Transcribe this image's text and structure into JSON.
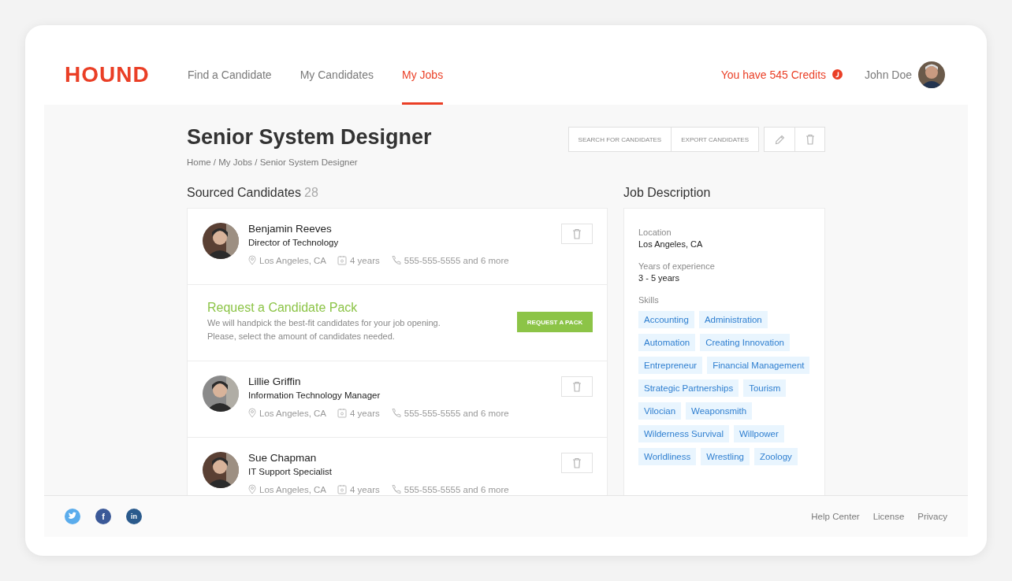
{
  "logo": "HOUND",
  "nav": [
    {
      "label": "Find a Candidate",
      "selected": false
    },
    {
      "label": "My Candidates",
      "selected": false
    },
    {
      "label": "My Jobs",
      "selected": true
    }
  ],
  "credits": "You have 545 Credits",
  "user": {
    "name": "John Doe"
  },
  "job": {
    "title": "Senior System Designer",
    "breadcrumb": "Home / My Jobs / Senior System Designer",
    "actions": [
      "SEARCH FOR CANDIDATES",
      "EXPORT CANDIDATES"
    ]
  },
  "candidates_section": {
    "heading": "Sourced Candidates",
    "count": "28",
    "items": [
      {
        "kind": "candidate",
        "name": "Benjamin Reeves",
        "title": "Director of Technology",
        "location": "Los Angeles, CA",
        "experience": "4 years",
        "phone": "555-555-5555 and 6 more"
      },
      {
        "kind": "pack",
        "title": "Request a Candidate Pack",
        "text": [
          "We will handpick the best-fit candidates for your job opening.",
          "Please, select the amount of candidates needed."
        ],
        "button": "REQUEST A PACK"
      },
      {
        "kind": "candidate",
        "name": "Lillie Griffin",
        "title": "Information Technology Manager",
        "location": "Los Angeles, CA",
        "experience": "4 years",
        "phone": "555-555-5555 and 6 more"
      },
      {
        "kind": "candidate",
        "name": "Sue Chapman",
        "title": "IT Support Specialist",
        "location": "Los Angeles, CA",
        "experience": "4 years",
        "phone": "555-555-5555 and 6 more"
      }
    ]
  },
  "job_description": {
    "heading": "Job Description",
    "fields": [
      {
        "label": "Location",
        "value": "Los Angeles, CA"
      },
      {
        "label": "Years of experience",
        "value": "3 - 5 years"
      }
    ],
    "skills_label": "Skills",
    "skills": [
      "Accounting",
      "Administration",
      "Automation",
      "Creating Innovation",
      "Entrepreneur",
      "Financial Management",
      "Strategic Partnerships",
      "Tourism",
      "Vilocian",
      "Weaponsmith",
      "Wilderness Survival",
      "Willpower",
      "Worldliness",
      "Wrestling",
      "Zoology"
    ]
  },
  "footer": {
    "social": [
      {
        "kind": "twitter"
      },
      {
        "kind": "facebook",
        "glyph": "f"
      },
      {
        "kind": "linkedin",
        "glyph": "in"
      }
    ],
    "links": [
      "Help Center",
      "License",
      "Privacy"
    ]
  }
}
